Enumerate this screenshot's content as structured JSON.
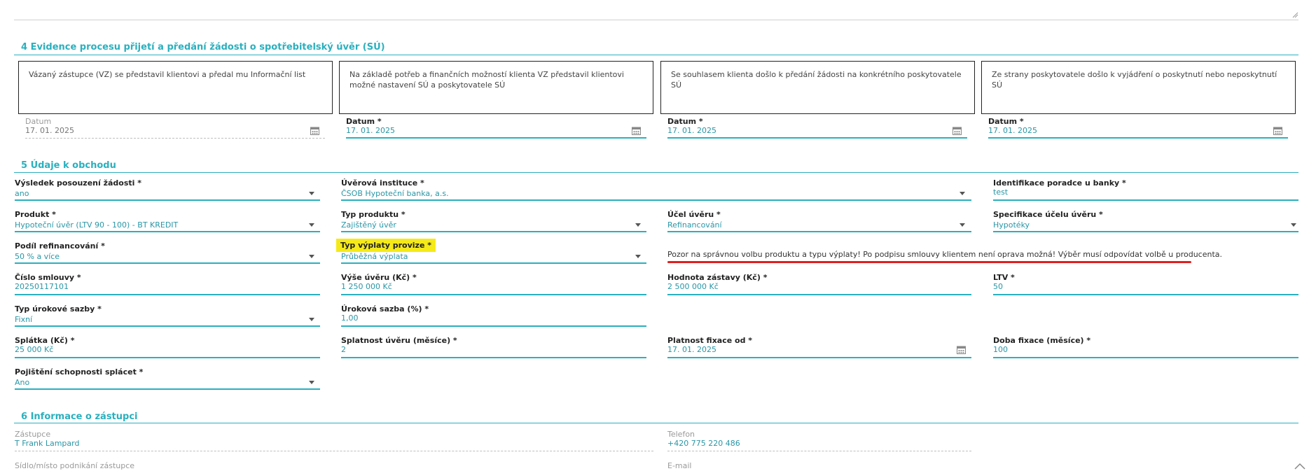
{
  "section4": {
    "title": "4 Evidence procesu přijetí a předání žádosti o spotřebitelský úvěr (SÚ)",
    "steps": [
      {
        "text": "Vázaný zástupce (VZ) se představil klientovi a předal mu Informační list",
        "date_label": "Datum",
        "date_value": "17. 01. 2025"
      },
      {
        "text": "Na základě potřeb a finančních možností klienta VZ představil klientovi možné nastavení SÚ a poskytovatele SÚ",
        "date_label": "Datum *",
        "date_value": "17. 01. 2025"
      },
      {
        "text": "Se souhlasem klienta došlo k předání žádosti na konkrétního poskytovatele SÚ",
        "date_label": "Datum *",
        "date_value": "17. 01. 2025"
      },
      {
        "text": "Ze strany poskytovatele došlo k vyjádření o poskytnutí nebo neposkytnutí SÚ",
        "date_label": "Datum *",
        "date_value": "17. 01. 2025"
      }
    ]
  },
  "section5": {
    "title": "5 Údaje k obchodu",
    "fields": {
      "vysledek": {
        "label": "Výsledek posouzení žádosti *",
        "value": "ano"
      },
      "instituce": {
        "label": "Úvěrová instituce *",
        "value": "ČSOB Hypoteční banka, a.s."
      },
      "poradce": {
        "label": "Identifikace poradce u banky *",
        "value": "test"
      },
      "produkt": {
        "label": "Produkt *",
        "value": "Hypoteční úvěr (LTV 90 - 100) - BT KREDIT"
      },
      "typ_produktu": {
        "label": "Typ produktu *",
        "value": "Zajištěný úvěr"
      },
      "ucel": {
        "label": "Účel úvěru *",
        "value": "Refinancování"
      },
      "specifikace": {
        "label": "Specifikace účelu úvěru *",
        "value": "Hypotéky"
      },
      "podil": {
        "label": "Podíl refinancování *",
        "value": "50 % a více"
      },
      "typ_vyplaty": {
        "label": "Typ výplaty provize *",
        "value": "Průběžná výplata"
      },
      "cislo_smlouvy": {
        "label": "Číslo smlouvy *",
        "value": "20250117101"
      },
      "vyse_uveru": {
        "label": "Výše úvěru (Kč) *",
        "value": "1 250 000 Kč"
      },
      "hodnota_zastavy": {
        "label": "Hodnota zástavy (Kč) *",
        "value": "2 500 000 Kč"
      },
      "ltv": {
        "label": "LTV *",
        "value": "50"
      },
      "typ_sazby": {
        "label": "Typ úrokové sazby *",
        "value": "Fixní"
      },
      "sazba": {
        "label": "Úroková sazba (%) *",
        "value": "1,00"
      },
      "splatka": {
        "label": "Splátka (Kč) *",
        "value": "25 000 Kč"
      },
      "splatnost": {
        "label": "Splatnost úvěru (měsíce) *",
        "value": "2"
      },
      "platnost_fixace": {
        "label": "Platnost fixace od *",
        "value": "17. 01. 2025"
      },
      "doba_fixace": {
        "label": "Doba fixace (měsíce) *",
        "value": "100"
      },
      "pojisteni": {
        "label": "Pojištění schopnosti splácet *",
        "value": "Ano"
      }
    },
    "warning": "Pozor na správnou volbu produktu a typu výplaty! Po podpisu smlouvy klientem není oprava možná! Výběr musí odpovídat volbě u producenta."
  },
  "section6": {
    "title": "6 Informace o zástupci",
    "zastupce": {
      "label": "Zástupce",
      "value": "T Frank Lampard"
    },
    "telefon": {
      "label": "Telefon",
      "value": "+420 775 220 486"
    },
    "sidlo": {
      "label": "Sídlo/místo podnikání zástupce"
    },
    "email": {
      "label": "E-mail"
    }
  },
  "colors": {
    "accent": "#2ab0be",
    "highlight": "#f5ea18",
    "annotation": "#e02020"
  },
  "icons": [
    "calendar-icon",
    "chevron-down-icon",
    "chevron-up-icon",
    "resize-grip-icon"
  ]
}
